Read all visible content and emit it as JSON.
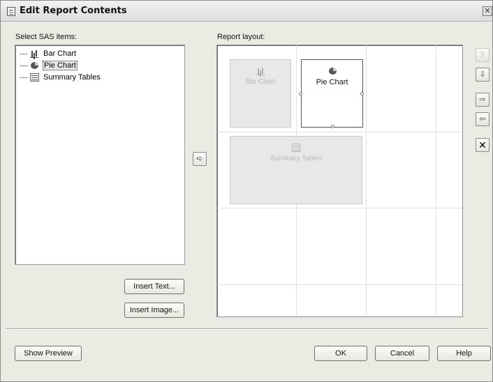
{
  "window": {
    "title": "Edit Report Contents"
  },
  "left_panel": {
    "label": "Select SAS items:",
    "items": [
      {
        "label": "Bar Chart",
        "icon": "bar-chart-icon"
      },
      {
        "label": "Pie Chart",
        "icon": "pie-chart-icon",
        "selected": true
      },
      {
        "label": "Summary Tables",
        "icon": "table-icon"
      }
    ],
    "insert_text": "Insert Text...",
    "insert_image": "Insert Image..."
  },
  "add_arrow": "➪",
  "layout": {
    "label": "Report layout:",
    "cells": [
      {
        "label": "Bar Chart",
        "icon": "bar-chart-icon",
        "state": "inactive"
      },
      {
        "label": "Pie Chart",
        "icon": "pie-chart-icon",
        "state": "selected"
      },
      {
        "label": "Summary Tables",
        "icon": "table-icon",
        "state": "inactive"
      }
    ]
  },
  "side_buttons": {
    "up": "⇧",
    "down": "⇩",
    "right": "⇨",
    "left": "⇦",
    "remove": "✕"
  },
  "footer": {
    "show_preview": "Show Preview",
    "ok": "OK",
    "cancel": "Cancel",
    "help": "Help"
  }
}
